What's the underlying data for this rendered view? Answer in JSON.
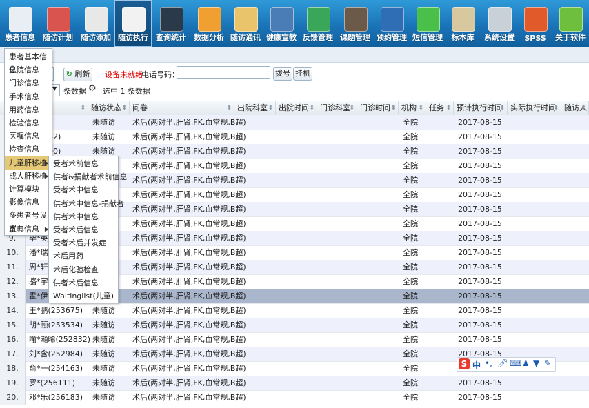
{
  "toolbar": {
    "items": [
      {
        "label": "患者信息",
        "icon": "patient-record-icon"
      },
      {
        "label": "随访计划",
        "icon": "calendar-plan-icon"
      },
      {
        "label": "随访添加",
        "icon": "add-document-icon"
      },
      {
        "label": "随访执行",
        "icon": "execute-icon",
        "active": true
      },
      {
        "label": "查询统计",
        "icon": "monitor-stats-icon"
      },
      {
        "label": "数据分析",
        "icon": "bar-chart-icon"
      },
      {
        "label": "随访通讯",
        "icon": "communication-icon"
      },
      {
        "label": "健康宣教",
        "icon": "health-education-icon"
      },
      {
        "label": "反馈管理",
        "icon": "feedback-icon"
      },
      {
        "label": "课题管理",
        "icon": "books-icon"
      },
      {
        "label": "预约管理",
        "icon": "appointment-user-icon"
      },
      {
        "label": "短信管理",
        "icon": "sms-bubble-icon"
      },
      {
        "label": "标本库",
        "icon": "specimen-icon"
      },
      {
        "label": "系统设置",
        "icon": "gear-icon"
      },
      {
        "label": "SPSS",
        "icon": "spss-chart-icon"
      },
      {
        "label": "关于软件",
        "icon": "about-software-icon"
      }
    ]
  },
  "actions": {
    "refresh_label": "刷新",
    "device_status": "设备未就绪",
    "phone_label": "电话号码：",
    "phone_value": "",
    "dial_label": "拨号",
    "hangup_label": "挂机"
  },
  "selection": {
    "per_page_suffix": "条数据",
    "selected_text": "选中 1 条数据"
  },
  "grid": {
    "columns": [
      "随访状态",
      "问卷",
      "出院科室",
      "出院时间",
      "门诊科室",
      "门诊时间",
      "机构",
      "任务",
      "预计执行时间",
      "实际执行时间",
      "随访人"
    ],
    "rows": [
      {
        "num": "",
        "patient": "3566)",
        "status": "未随访",
        "questionnaire": "术后(两对半,肝肾,FK,血常规,B超)",
        "org": "全院",
        "planned": "2017-08-15"
      },
      {
        "num": "",
        "patient": "253582)",
        "status": "未随访",
        "questionnaire": "术后(两对半,肝肾,FK,血常规,B超)",
        "org": "全院",
        "planned": "2017-08-15"
      },
      {
        "num": "",
        "patient": "253100)",
        "status": "未随访",
        "questionnaire": "术后(两对半,肝肾,FK,血常规,B超)",
        "org": "全院",
        "planned": "2017-08-15"
      },
      {
        "num": "",
        "patient": "",
        "status": "",
        "questionnaire": "术后(两对半,肝肾,FK,血常规,B超)",
        "org": "全院",
        "planned": "2017-08-15"
      },
      {
        "num": "",
        "patient": "",
        "status": "",
        "questionnaire": "术后(两对半,肝肾,FK,血常规,B超)",
        "org": "全院",
        "planned": "2017-08-15"
      },
      {
        "num": "",
        "patient": "",
        "status": "",
        "questionnaire": "术后(两对半,肝肾,FK,血常规,B超)",
        "org": "全院",
        "planned": "2017-08-15"
      },
      {
        "num": "",
        "patient": "",
        "status": "",
        "questionnaire": "术后(两对半,肝肾,FK,血常规,B超)",
        "org": "全院",
        "planned": "2017-08-15"
      },
      {
        "num": "",
        "patient": "",
        "status": "",
        "questionnaire": "术后(两对半,肝肾,FK,血常规,B超)",
        "org": "全院",
        "planned": "2017-08-15"
      },
      {
        "num": "9.",
        "patient": "毕*英",
        "status": "",
        "questionnaire": "术后(两对半,肝肾,FK,血常规,B超)",
        "org": "全院",
        "planned": "2017-08-15"
      },
      {
        "num": "10.",
        "patient": "潘*瑞",
        "status": "",
        "questionnaire": "术后(两对半,肝肾,FK,血常规,B超)",
        "org": "全院",
        "planned": "2017-08-15"
      },
      {
        "num": "11.",
        "patient": "周*轩",
        "status": "",
        "questionnaire": "术后(两对半,肝肾,FK,血常规,B超)",
        "org": "全院",
        "planned": "2017-08-15"
      },
      {
        "num": "12.",
        "patient": "骆*宇",
        "status": "",
        "questionnaire": "术后(两对半,肝肾,FK,血常规,B超)",
        "org": "全院",
        "planned": "2017-08-15"
      },
      {
        "num": "13.",
        "patient": "霍*伊",
        "status": "",
        "questionnaire": "术后(两对半,肝肾,FK,血常规,B超)",
        "org": "全院",
        "planned": "2017-08-15",
        "selected": true
      },
      {
        "num": "14.",
        "patient": "王*鹏(253675)",
        "status": "未随访",
        "questionnaire": "术后(两对半,肝肾,FK,血常规,B超)",
        "org": "全院",
        "planned": "2017-08-15"
      },
      {
        "num": "15.",
        "patient": "胡*颐(253534)",
        "status": "未随访",
        "questionnaire": "术后(两对半,肝肾,FK,血常规,B超)",
        "org": "全院",
        "planned": "2017-08-15"
      },
      {
        "num": "16.",
        "patient": "喻*瀚晞(252832)",
        "status": "未随访",
        "questionnaire": "术后(两对半,肝肾,FK,血常规,B超)",
        "org": "全院",
        "planned": "2017-08-15"
      },
      {
        "num": "17.",
        "patient": "刘*含(252984)",
        "status": "未随访",
        "questionnaire": "术后(两对半,肝肾,FK,血常规,B超)",
        "org": "全院",
        "planned": "2017-08-15"
      },
      {
        "num": "18.",
        "patient": "俞*一(254163)",
        "status": "未随访",
        "questionnaire": "术后(两对半,肝肾,FK,血常规,B超)",
        "org": "全院",
        "planned": ""
      },
      {
        "num": "19.",
        "patient": "罗*(256111)",
        "status": "未随访",
        "questionnaire": "术后(两对半,肝肾,FK,血常规,B超)",
        "org": "全院",
        "planned": "2017-08-15"
      },
      {
        "num": "20.",
        "patient": "邓*乐(256183)",
        "status": "未随访",
        "questionnaire": "术后(两对半,肝肾,FK,血常规,B超)",
        "org": "全院",
        "planned": "2017-08-15"
      }
    ]
  },
  "sidemenu": {
    "items": [
      {
        "label": "患者基本信息"
      },
      {
        "label": "住院信息"
      },
      {
        "label": "门诊信息"
      },
      {
        "label": "手术信息"
      },
      {
        "label": "用药信息"
      },
      {
        "label": "检验信息"
      },
      {
        "label": "医嘱信息"
      },
      {
        "label": "检查信息"
      },
      {
        "label": "儿童肝移植",
        "submenu": true,
        "highlight": true
      },
      {
        "label": "成人肝移植",
        "submenu": true
      },
      {
        "label": "计算模块"
      },
      {
        "label": "影像信息"
      },
      {
        "label": "多患者号设置"
      },
      {
        "label": "字典信息",
        "submenu": true
      }
    ]
  },
  "submenu": {
    "items": [
      "受者术前信息",
      "供者&捐献者术前信息",
      "受者术中信息",
      "供者术中信息-捐献者",
      "供者术中信息",
      "受者术后信息",
      "受者术后并发症",
      "术后用药",
      "术后化验检查",
      "供者术后信息",
      "Waitinglist(儿童)"
    ]
  },
  "ime": {
    "mode_label": "中"
  },
  "colors": {
    "toolbar": "#1a74b8",
    "menu_highlight": "#e6c977",
    "selected_row": "#a9b6cc",
    "alt_row": "#eef1fb",
    "warning": "#e00000"
  }
}
